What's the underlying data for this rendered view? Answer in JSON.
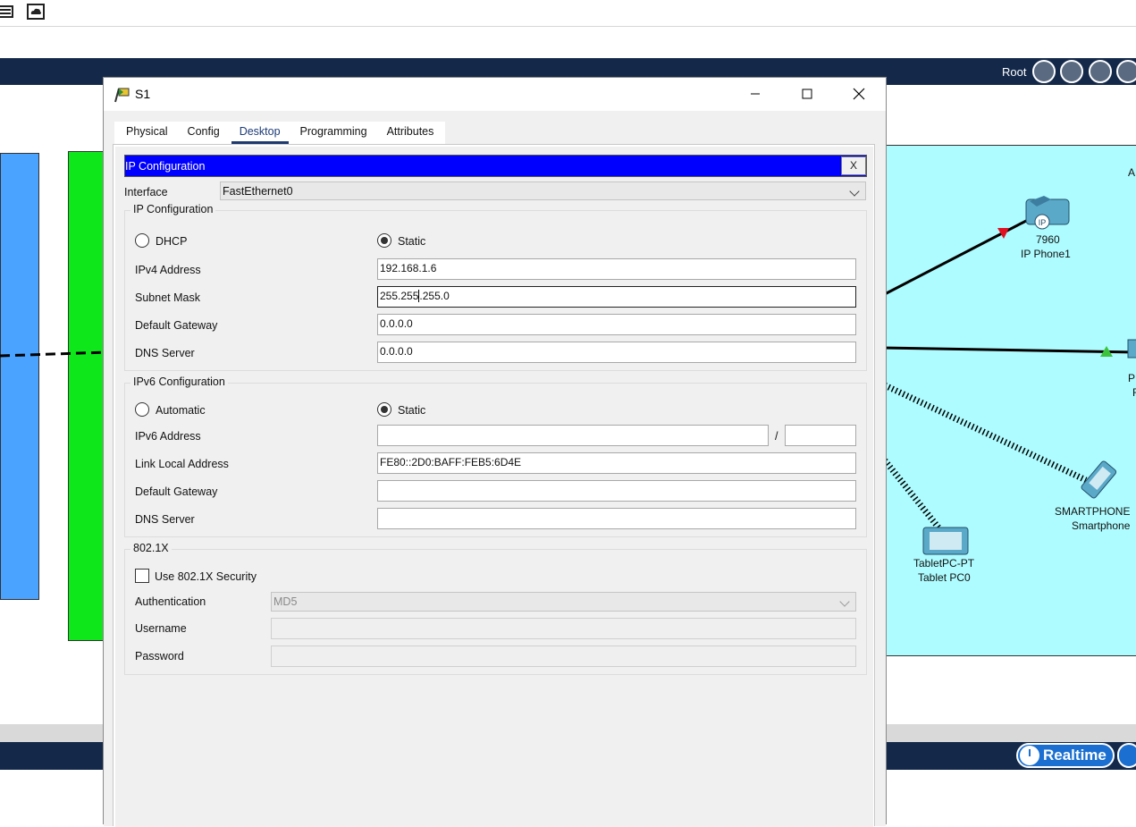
{
  "window": {
    "title": "S1",
    "tabs": [
      "Physical",
      "Config",
      "Desktop",
      "Programming",
      "Attributes"
    ],
    "active_tab": "Desktop"
  },
  "topbar": {
    "root_label": "Root"
  },
  "bottom_bar": {
    "realtime_label": "Realtime"
  },
  "workspace": {
    "devices": [
      {
        "type_label": "7960",
        "name": "IP Phone1"
      },
      {
        "type_label": "SMARTPHONE",
        "name": "Smartphone"
      },
      {
        "type_label": "TabletPC-PT",
        "name": "Tablet PC0"
      }
    ],
    "clipped_fragments": {
      "a": "A",
      "p": "P",
      "f": "F"
    }
  },
  "ip_config": {
    "header": "IP Configuration",
    "close": "X",
    "interface_label": "Interface",
    "interface_value": "FastEthernet0",
    "ipv4": {
      "title": "IP Configuration",
      "dhcp_label": "DHCP",
      "static_label": "Static",
      "mode": "Static",
      "address_label": "IPv4 Address",
      "address": "192.168.1.6",
      "mask_label": "Subnet Mask",
      "mask_before_caret": "255.255",
      "mask_after_caret": ".255.0",
      "gateway_label": "Default Gateway",
      "gateway": "0.0.0.0",
      "dns_label": "DNS Server",
      "dns": "0.0.0.0"
    },
    "ipv6": {
      "title": "IPv6 Configuration",
      "auto_label": "Automatic",
      "static_label": "Static",
      "mode": "Static",
      "address_label": "IPv6 Address",
      "address": "",
      "prefix_sep": "/",
      "prefix": "",
      "link_local_label": "Link Local Address",
      "link_local": "FE80::2D0:BAFF:FEB5:6D4E",
      "gateway_label": "Default Gateway",
      "gateway": "",
      "dns_label": "DNS Server",
      "dns": ""
    },
    "dot1x": {
      "title": "802.1X",
      "use_label": "Use 802.1X Security",
      "enabled": false,
      "auth_label": "Authentication",
      "auth_value": "MD5",
      "username_label": "Username",
      "username": "",
      "password_label": "Password",
      "password": ""
    }
  },
  "colors": {
    "config_header": "#0000ff",
    "nav_bar": "#14294a",
    "cluster_blue": "#4aa3ff",
    "cluster_green": "#0ee81b",
    "cluster_cyan": "#aefcff"
  }
}
